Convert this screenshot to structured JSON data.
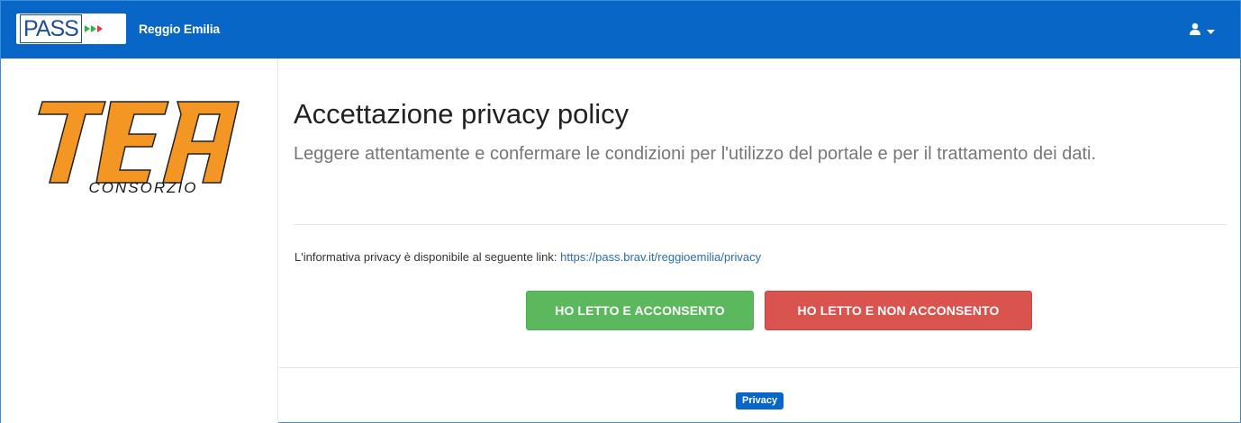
{
  "navbar": {
    "logo_text": "PASS",
    "app_title": "Reggio Emilia",
    "user_icon": "user-icon",
    "caret_icon": "caret-down-icon",
    "bg_color": "#0866c6"
  },
  "sidebar": {
    "logo_text": "TEA",
    "logo_subtext": "CONSORZIO",
    "logo_color": "#f39623"
  },
  "main": {
    "title": "Accettazione privacy policy",
    "subtitle": "Leggere attentamente e confermare le condizioni per l'utilizzo del portale e per il trattamento dei dati.",
    "info_text": "L'informativa privacy è disponibile al seguente link: ",
    "info_link": "https://pass.brav.it/reggioemilia/privacy",
    "accept_label": "HO LETTO E ACCONSENTO",
    "decline_label": "HO LETTO E NON ACCONSENTO",
    "accept_color": "#5cb85c",
    "decline_color": "#d9534f"
  },
  "footer": {
    "privacy_label": "Privacy"
  }
}
